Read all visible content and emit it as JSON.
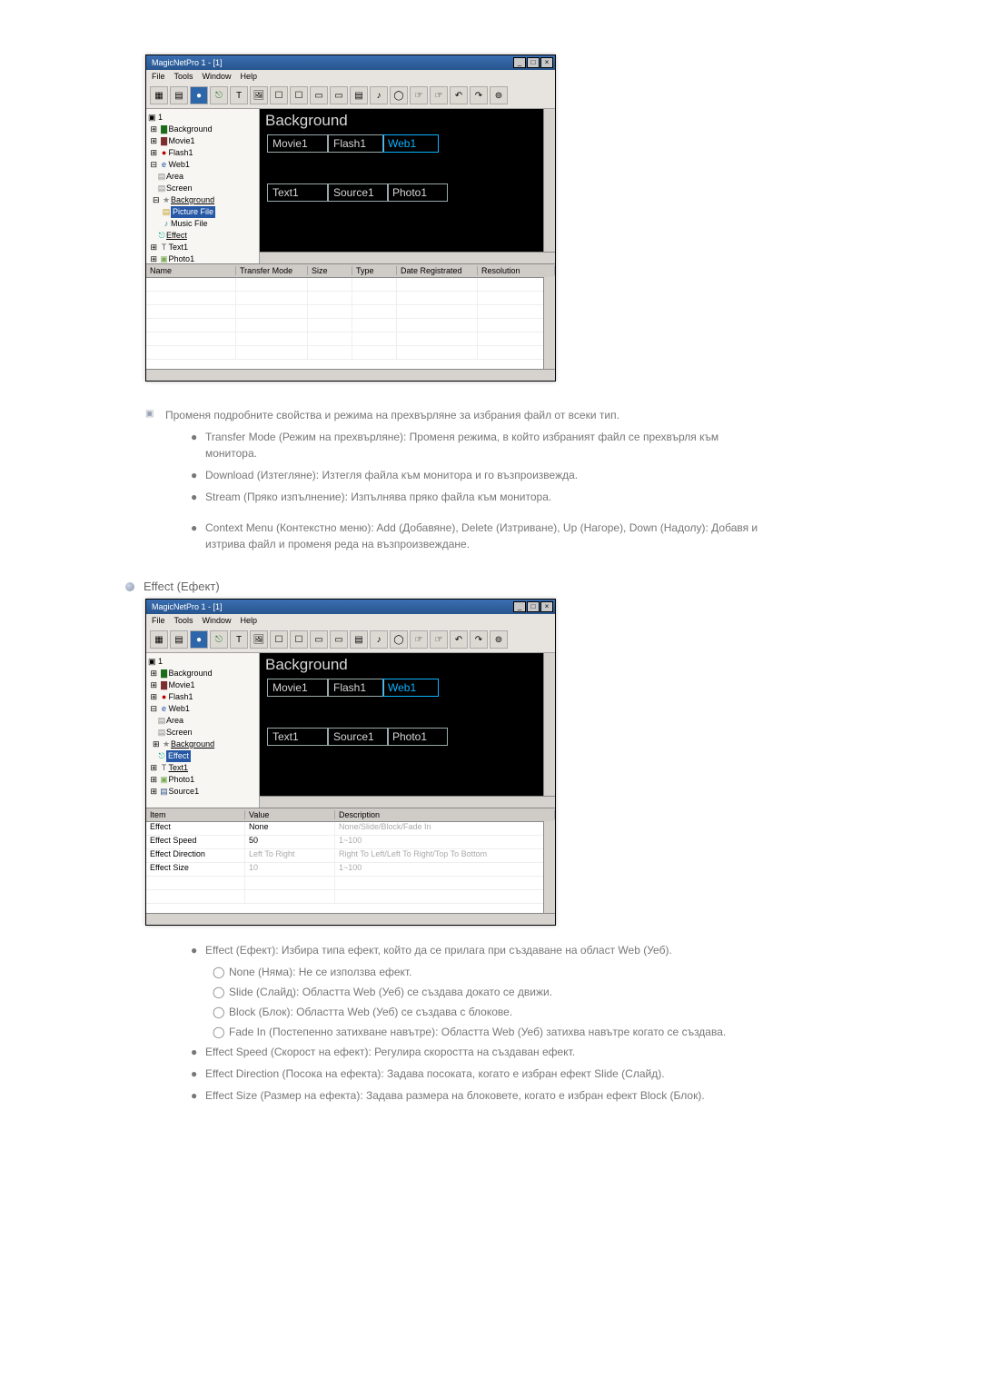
{
  "app": {
    "title": "MagicNetPro 1 - [1]",
    "menu": {
      "file": "File",
      "tools": "Tools",
      "window": "Window",
      "help": "Help"
    },
    "canvas": {
      "header": "Background",
      "boxes": {
        "movie": "Movie1",
        "flash": "Flash1",
        "web": "Web1",
        "text": "Text1",
        "source": "Source1",
        "photo": "Photo1"
      }
    },
    "tree": {
      "root": "1",
      "bg": "Background",
      "movie": "Movie1",
      "flash": "Flash1",
      "web": "Web1",
      "area": "Area",
      "screen": "Screen",
      "bg2": "Background",
      "picfile": "Picture File",
      "musfile": "Music File",
      "effect": "Effect",
      "text": "Text1",
      "photo": "Photo1",
      "source": "Source1"
    }
  },
  "table1": {
    "cols": {
      "name": "Name",
      "mode": "Transfer Mode",
      "size": "Size",
      "type": "Type",
      "date": "Date Registrated",
      "res": "Resolution"
    }
  },
  "table2": {
    "cols": {
      "item": "Item",
      "value": "Value",
      "desc": "Description"
    },
    "rows": {
      "r0": {
        "item": "Effect",
        "value": "None",
        "desc": "None/Slide/Block/Fade In"
      },
      "r1": {
        "item": "Effect Speed",
        "value": "50",
        "desc": "1~100"
      },
      "r2": {
        "item": "Effect Direction",
        "value": "Left To Right",
        "desc": "Right To Left/Left To Right/Top To Bottom"
      },
      "r3": {
        "item": "Effect Size",
        "value": "10",
        "desc": "1~100"
      }
    }
  },
  "text": {
    "para1": "Променя подробните свойства и режима на прехвърляне за избрания файл от всеки тип.",
    "l1": "Transfer Mode (Режим на прехвърляне): Променя режима, в който избраният файл се прехвърля към монитора.",
    "l2": "Download (Изтегляне): Изтегля файла към монитора и го възпроизвежда.",
    "l3": "Stream (Пряко изпълнение): Изпълнява пряко файла към монитора.",
    "l4": "Context Menu (Контекстно меню): Add (Добавяне), Delete (Изтриване), Up (Нагоре), Down (Надолу): Добавя и изтрива файл и променя реда на възпроизвеждане.",
    "section2": "Effect (Ефект)",
    "e1": "Effect (Ефект): Избира типа ефект, който да се прилага при създаване на област Web (Уеб).",
    "e1a": "None (Няма): Не се използва ефект.",
    "e1b": "Slide (Слайд): Областта Web (Уеб) се създава докато се движи.",
    "e1c": "Block (Блок): Областта Web (Уеб) се създава с блокове.",
    "e1d": "Fade In (Постепенно затихване навътре): Областта Web (Уеб) затихва навътре когато се създава.",
    "e2": "Effect Speed (Скорост на ефект): Регулира скоростта на създаван ефект.",
    "e3": "Effect Direction (Посока на ефекта): Задава посоката, когато е избран ефект Slide (Слайд).",
    "e4": "Effect Size (Размер на ефекта): Задава размера на блоковете, когато е избран ефект Block (Блок)."
  },
  "glyph": {
    "T": "T",
    "circ": "◯"
  }
}
